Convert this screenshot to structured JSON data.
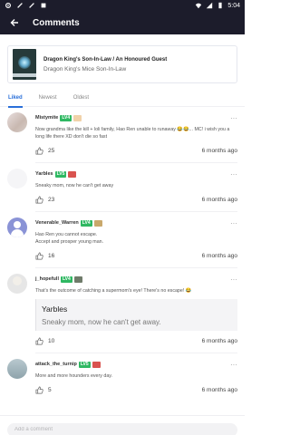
{
  "status_bar": {
    "time": "5:04",
    "icons": [
      "gear-icon",
      "wrench-icon",
      "wrench-icon",
      "notification-icon",
      "wifi-icon",
      "signal-icon",
      "battery-icon"
    ]
  },
  "app_bar": {
    "title": "Comments",
    "back_icon": "arrow-left-icon"
  },
  "book": {
    "title": "Dragon King's Son-In-Law / An Honoured Guest",
    "subtitle": "Dragon King's Mice Son-In-Law"
  },
  "tabs": [
    {
      "label": "Liked",
      "active": true
    },
    {
      "label": "Newest",
      "active": false
    },
    {
      "label": "Oldest",
      "active": false
    }
  ],
  "comments": [
    {
      "name": "Mistymite",
      "level": "LV4",
      "text": "Now grandma like the kill + loli family, Hao Ren unable to runaway 😂😂... MC! i wish you a long life there XD don't die so fast",
      "likes": "25",
      "time": "6 months ago"
    },
    {
      "name": "Yarbles",
      "level": "LV5",
      "text": "Sneaky mom, now he can't get away",
      "likes": "23",
      "time": "6 months ago"
    },
    {
      "name": "Venerable_Warren",
      "level": "LV4",
      "text": "Hao Ren you cannot escape.\nAccept and prosper young man.",
      "likes": "16",
      "time": "6 months ago"
    },
    {
      "name": "j_hopefull",
      "level": "LV4",
      "text": "That's the outcome of catching a supermom's eye! There's no escape! 😂",
      "quote": {
        "name": "Yarbles",
        "text": "Sneaky mom, now he can't get away."
      },
      "likes": "10",
      "time": "6 months ago"
    },
    {
      "name": "attack_the_turnip",
      "level": "LV5",
      "text": "More and more hounders every day.",
      "likes": "5",
      "time": "6 months ago"
    }
  ],
  "add_comment": {
    "placeholder": "Add a comment"
  },
  "colors": {
    "header_bg": "#1c1c2b",
    "accent": "#2a6fd9",
    "level_badge": "#2fb862"
  }
}
